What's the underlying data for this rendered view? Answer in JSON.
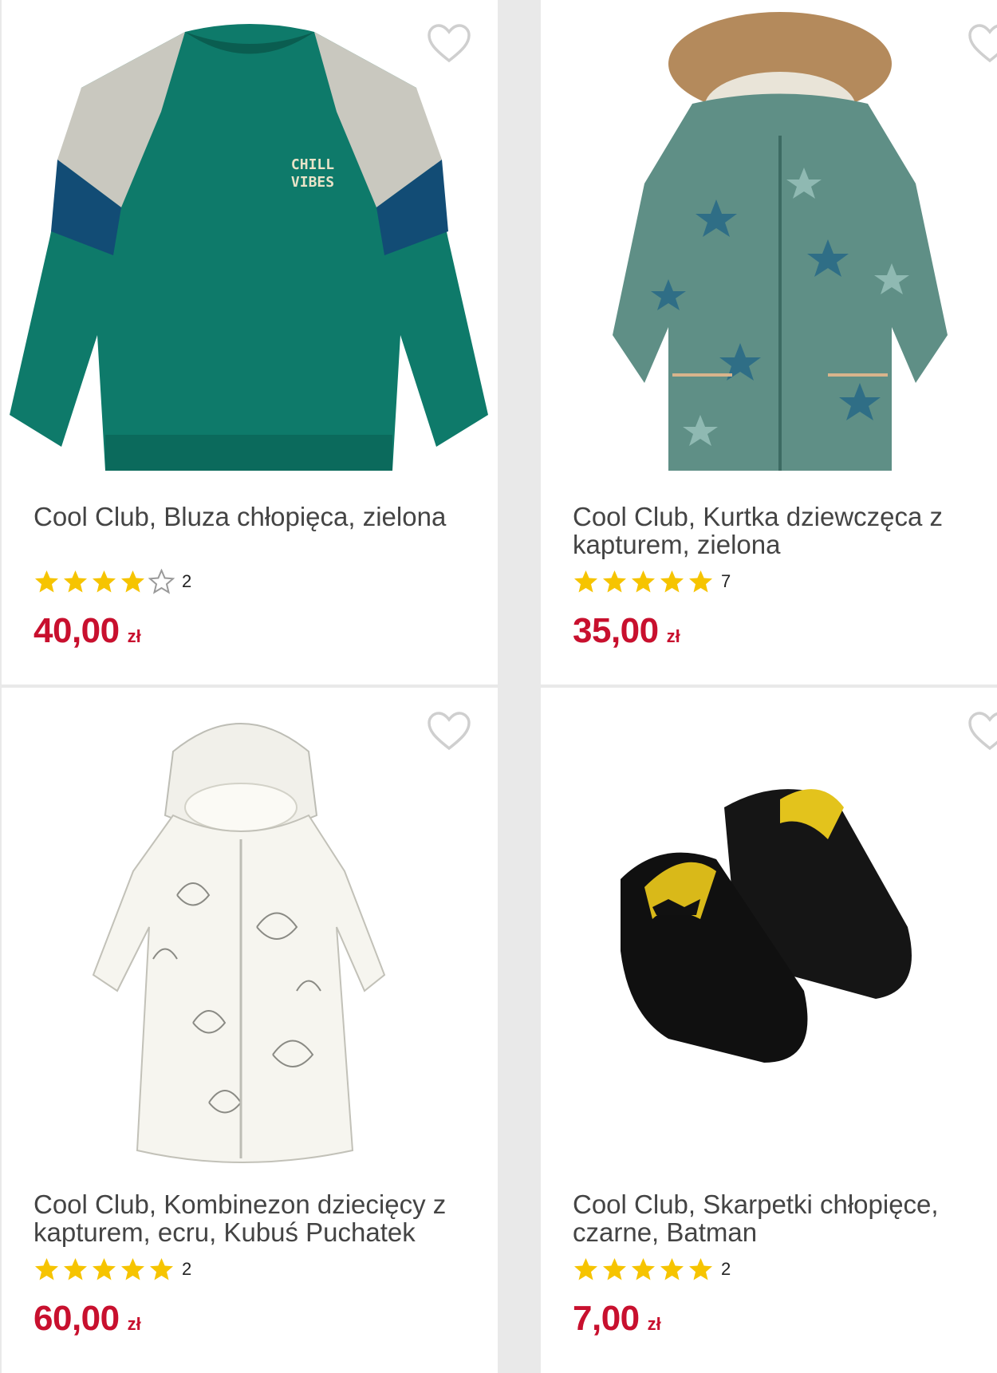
{
  "colors": {
    "price": "#c8102e",
    "star": "#f6c400",
    "star_outline": "#9a9a9a",
    "heart": "#cfcfcf"
  },
  "icons": {
    "favorite": "heart-icon",
    "rating": "star-icon"
  },
  "products": [
    {
      "title": "Cool Club, Bluza chłopięca, zielona",
      "rating": 4,
      "reviews": "2",
      "price": "40,00",
      "currency": "zł"
    },
    {
      "title": "Cool Club, Kurtka dziewczęca z kapturem, zielona",
      "rating": 5,
      "reviews": "7",
      "price": "35,00",
      "currency": "zł"
    },
    {
      "title": "Cool Club, Kombinezon dziecięcy z kapturem, ecru, Kubuś Puchatek",
      "rating": 5,
      "reviews": "2",
      "price": "60,00",
      "currency": "zł"
    },
    {
      "title": "Cool Club, Skarpetki chłopięce, czarne, Batman",
      "rating": 5,
      "reviews": "2",
      "price": "7,00",
      "currency": "zł"
    }
  ]
}
